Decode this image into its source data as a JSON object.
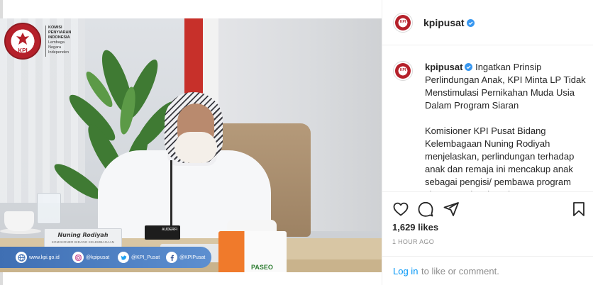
{
  "colors": {
    "link": "#0095f6",
    "verified": "#3897f0",
    "text_primary": "#262626",
    "text_secondary": "#8e8e8e",
    "social_bar": "#4a7cc0",
    "kpi_red": "#b5202a"
  },
  "photo": {
    "logo": {
      "seal_text": "KPI",
      "lines": [
        "KOMISI",
        "PENYIARAN",
        "INDONESIA",
        "Lembaga",
        "Negara",
        "Independen"
      ]
    },
    "nameplate": {
      "name": "Nuning Rodiyah",
      "role": "KOMISIONER BIDANG KELEMBAGAAN"
    },
    "device_label": "AUDERFI",
    "tissue_brand": "PASEO",
    "social_bar": [
      {
        "icon": "globe-icon",
        "text": "www.kpi.go.id"
      },
      {
        "icon": "instagram-icon",
        "text": "@kpipusat"
      },
      {
        "icon": "twitter-icon",
        "text": "@KPI_Pusat"
      },
      {
        "icon": "facebook-icon",
        "text": "@KPIPusat"
      }
    ]
  },
  "post": {
    "username": "kpipusat",
    "verified": true,
    "caption_title": "Ingatkan Prinsip Perlindungan Anak, KPI Minta LP Tidak Menstimulasi Pernikahan Muda Usia Dalam Program Siaran",
    "caption_body": "Komisioner KPI Pusat Bidang Kelembagaan Nuning Rodiyah menjelaskan, perlindungan terhadap anak dan remaja ini mencakup anak sebagai pengisi/ pembawa program siaran, anak sebagai",
    "likes": "1,629 likes",
    "time": "1 HOUR AGO",
    "login_link": "Log in",
    "login_rest": "to like or comment."
  },
  "actions": {
    "like": "heart-icon",
    "comment": "comment-icon",
    "share": "share-icon",
    "save": "bookmark-icon"
  }
}
